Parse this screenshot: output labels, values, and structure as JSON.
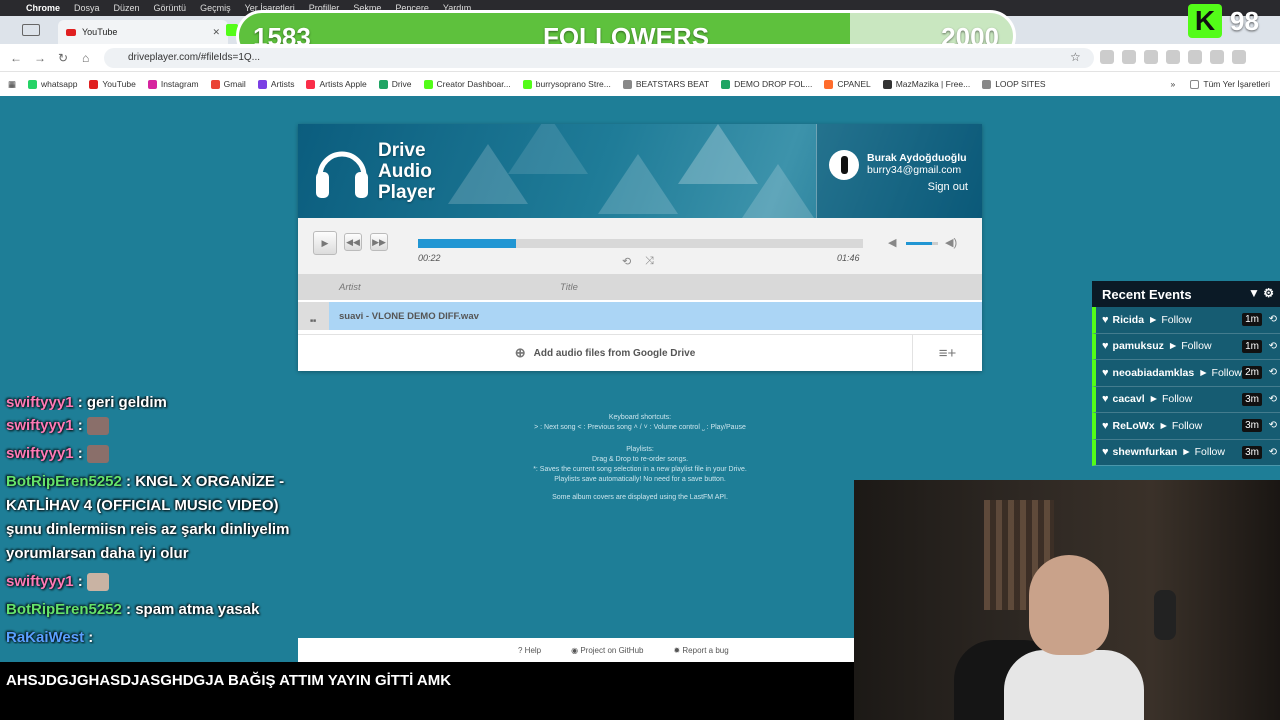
{
  "macbar": {
    "app": "Chrome",
    "menus": [
      "Dosya",
      "Düzen",
      "Görüntü",
      "Geçmiş",
      "Yer İşaretleri",
      "Profiller",
      "Sekme",
      "Pencere",
      "Yardım"
    ]
  },
  "tabs": {
    "active_title": "YouTube"
  },
  "goal": {
    "current": "1583",
    "label": "FOLLOWERS",
    "target": "2000",
    "progress": 0.79
  },
  "kick": {
    "logo": "K",
    "count": "98"
  },
  "address": {
    "url": "driveplayer.com/#fileIds=1Q..."
  },
  "bookmarks": [
    {
      "label": "whatsapp",
      "color": "#25d366"
    },
    {
      "label": "YouTube",
      "color": "#e02020"
    },
    {
      "label": "Instagram",
      "color": "#d6249f"
    },
    {
      "label": "Gmail",
      "color": "#ea4335"
    },
    {
      "label": "Artists",
      "color": "#7b3fe4"
    },
    {
      "label": "Artists Apple",
      "color": "#fa2d48"
    },
    {
      "label": "Drive",
      "color": "#1fa463"
    },
    {
      "label": "Creator Dashboar...",
      "color": "#53fc18"
    },
    {
      "label": "burrysoprano Stre...",
      "color": "#53fc18"
    },
    {
      "label": "BEATSTARS BEAT",
      "color": "#888888"
    },
    {
      "label": "DEMO DROP FOL...",
      "color": "#1fa463"
    },
    {
      "label": "CPANEL",
      "color": "#ff6c2c"
    },
    {
      "label": "MazMazika | Free...",
      "color": "#333333"
    },
    {
      "label": "LOOP SITES",
      "color": "#888888"
    }
  ],
  "bookmarks_right": "Tüm Yer İşaretleri",
  "player": {
    "logo_lines": [
      "Drive",
      "Audio",
      "Player"
    ],
    "user_name": "Burak Aydoğduoğlu",
    "user_email": "burry34@gmail.com",
    "signout": "Sign out",
    "time_current": "00:22",
    "time_total": "01:46",
    "progress": 0.22,
    "volume": 0.8,
    "col_artist": "Artist",
    "col_title": "Title",
    "track": "suavi - VLONE DEMO DIFF.wav",
    "add_label": "Add audio files from Google Drive"
  },
  "help": {
    "shortcuts_title": "Keyboard shortcuts:",
    "shortcuts": "˃ : Next song  ˂ : Previous song  ˄ / ˅ : Volume control  ˽ : Play/Pause",
    "playlists_title": "Playlists:",
    "pl1": "Drag & Drop to re-order songs.",
    "pl2": "*: Saves the current song selection in a new playlist file in your Drive.",
    "pl3": "Playlists save automatically! No need for a save button.",
    "lastfm": "Some album covers are displayed using the LastFM API."
  },
  "footer": {
    "help": "Help",
    "github": "Project on GitHub",
    "bug": "Report a bug"
  },
  "chat": {
    "m1_user": "swiftyyy1",
    "m1_text": ": geri geldim",
    "m2_user": "swiftyyy1",
    "m2_text": ":",
    "m3_user": "swiftyyy1",
    "m3_text": ":",
    "m4_user": "BotRipEren5252",
    "m4_text": ": KNGL X ORGANİZE - KATLİHAV 4 (OFFICIAL MUSIC VIDEO) şunu dinlermiisn reis az şarkı dinliyelim yorumlarsan daha iyi olur",
    "m5_user": "swiftyyy1",
    "m5_text": ":",
    "m6_user": "BotRipEren5252",
    "m6_text": ": spam atma yasak",
    "m7_user": "RaKaiWest",
    "m7_text": ":",
    "bottom": "AHSJDGJGHASDJASGHDGJA BAĞIŞ ATTIM YAYIN GİTTİ AMK"
  },
  "events": {
    "title": "Recent Events",
    "items": [
      {
        "name": "Ricida",
        "action": "► Follow",
        "time": "1m"
      },
      {
        "name": "pamuksuz",
        "action": "► Follow",
        "time": "1m"
      },
      {
        "name": "neoabiadamklas",
        "action": "► Follow",
        "time": "2m"
      },
      {
        "name": "cacavl",
        "action": "► Follow",
        "time": "3m"
      },
      {
        "name": "ReLoWx",
        "action": "► Follow",
        "time": "3m"
      },
      {
        "name": "shewnfurkan",
        "action": "► Follow",
        "time": "3m"
      }
    ]
  },
  "colors": {
    "accent": "#2196d3",
    "kick": "#53fc18",
    "page_bg": "#1e7e97"
  }
}
